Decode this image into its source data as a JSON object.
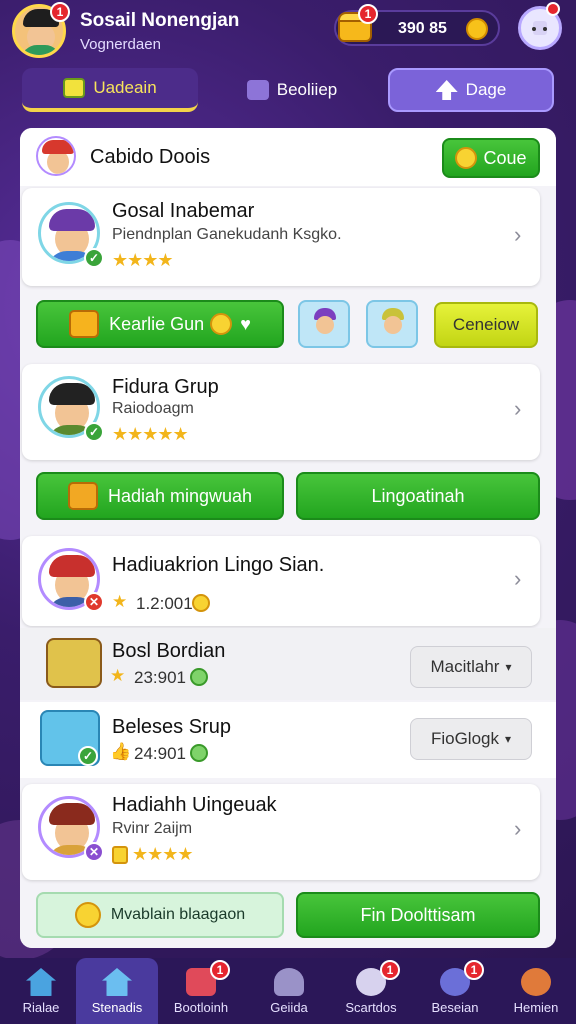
{
  "player": {
    "name": "Sosail Nonengjan",
    "subtitle": "Vognerdaen",
    "notif_count": "1"
  },
  "currency": {
    "value": "390 85",
    "badge": "1"
  },
  "tabs": [
    {
      "label": "Uadeain"
    },
    {
      "label": "Beoliiep"
    },
    {
      "label": "Dage"
    }
  ],
  "section": {
    "title": "Cabido Doois",
    "button": "Coue"
  },
  "entries": [
    {
      "title": "Gosal Inabemar",
      "subtitle": "Piendnplan Ganekudanh Ksgko.",
      "stars": "★★★★"
    },
    {
      "title": "Fidura Grup",
      "subtitle": "Raiodoagm",
      "stars": "★★★★★"
    },
    {
      "title": "Hadiuakrion Lingo Sian.",
      "value": "1.2:001"
    },
    {
      "title": "Bosl Bordian",
      "value": "23:901",
      "dropdown": "Macitlahr"
    },
    {
      "title": "Beleses Srup",
      "value": "24:901",
      "dropdown": "FioGlogk"
    },
    {
      "title": "Hadiahh Uingeuak",
      "subtitle": "Rvinr 2aijm",
      "stars": "★★★★"
    }
  ],
  "actions": {
    "gift_button": "Kearlie Gun",
    "yellow_button": "Ceneiow",
    "reward_left": "Hadiah mingwuah",
    "reward_right": "Lingoatinah",
    "bottom_left": "Mvablain blaagaon",
    "bottom_right": "Fin Doolttisam"
  },
  "nav": [
    {
      "label": "Rialae",
      "badge": ""
    },
    {
      "label": "Stenadis",
      "badge": ""
    },
    {
      "label": "Bootloinh",
      "badge": "1"
    },
    {
      "label": "Geiida",
      "badge": ""
    },
    {
      "label": "Scartdos",
      "badge": "1"
    },
    {
      "label": "Beseian",
      "badge": "1"
    },
    {
      "label": "Hemien",
      "badge": ""
    }
  ],
  "colors": {
    "accent": "#22a51f",
    "bg": "#3b1f6e",
    "nav": "#2b1758"
  }
}
